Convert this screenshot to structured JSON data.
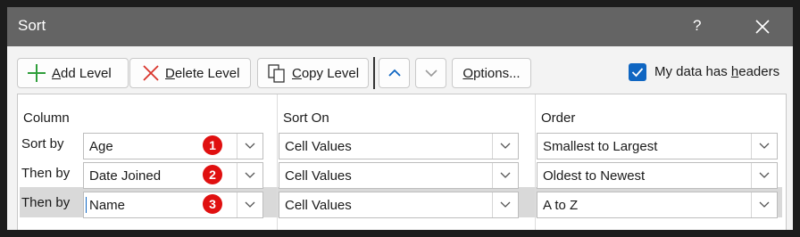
{
  "window": {
    "title": "Sort",
    "help_label": "?"
  },
  "toolbar": {
    "add_level": {
      "pre": "",
      "key": "A",
      "post": "dd Level"
    },
    "delete_level": {
      "pre": "",
      "key": "D",
      "post": "elete Level"
    },
    "copy_level": {
      "pre": "",
      "key": "C",
      "post": "opy Level"
    },
    "options": {
      "pre": "",
      "key": "O",
      "post": "ptions..."
    }
  },
  "headers_option": {
    "label_pre": "My data has ",
    "label_key": "h",
    "label_post": "eaders",
    "checked": true
  },
  "columns": {
    "column": "Column",
    "sort_on": "Sort On",
    "order": "Order"
  },
  "rows": [
    {
      "label": "Sort by",
      "column": "Age",
      "badge": "1",
      "sort_on": "Cell Values",
      "order": "Smallest to Largest"
    },
    {
      "label": "Then by",
      "column": "Date Joined",
      "badge": "2",
      "sort_on": "Cell Values",
      "order": "Oldest to Newest"
    },
    {
      "label": "Then by",
      "column": "Name",
      "badge": "3",
      "sort_on": "Cell Values",
      "order": "A to Z"
    }
  ],
  "colors": {
    "titlebar": "#646464",
    "accent": "#0f66c2",
    "badge": "#e01010"
  },
  "icons": [
    "plus-icon",
    "x-icon",
    "copy-icon",
    "arrow-up-icon",
    "arrow-down-icon",
    "check-icon",
    "close-icon",
    "chevron-down-icon"
  ]
}
